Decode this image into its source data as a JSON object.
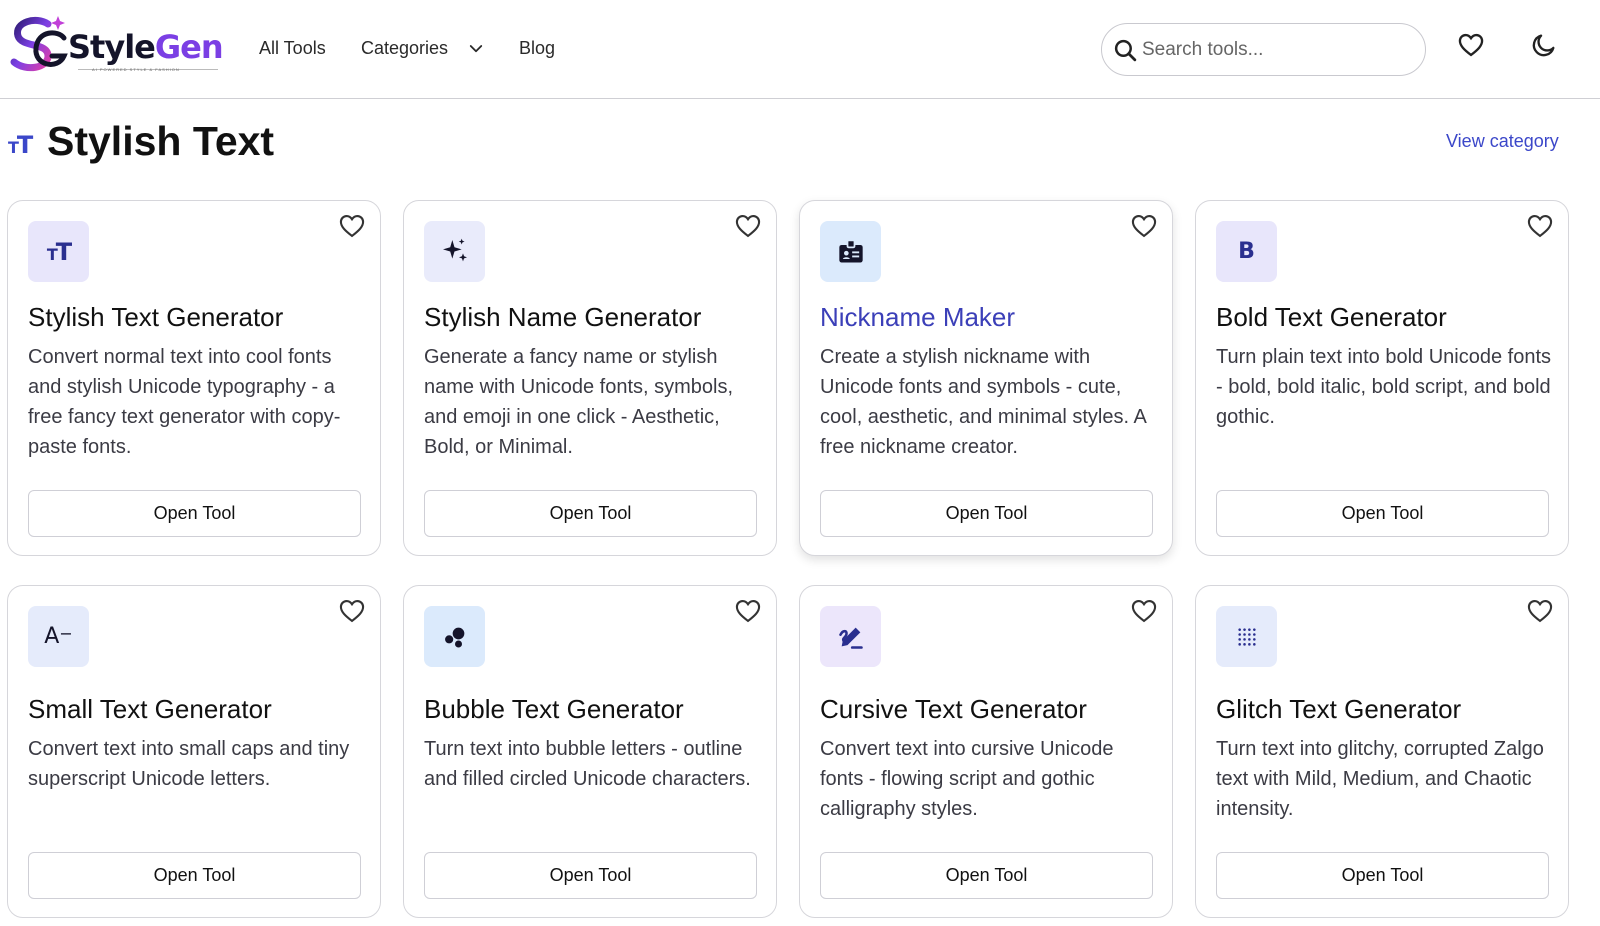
{
  "brand": {
    "name_part1": "Style",
    "name_part2": "Gen",
    "tagline": "AI POWERED STYLE & FASHION"
  },
  "nav": {
    "all_tools": "All Tools",
    "categories": "Categories",
    "blog": "Blog"
  },
  "search": {
    "placeholder": "Search tools..."
  },
  "section": {
    "title": "Stylish Text",
    "view_link": "View category"
  },
  "cards": [
    {
      "title": "Stylish Text Generator",
      "description": "Convert normal text into cool fonts and stylish Unicode typography - a free fancy text generator with copy-paste fonts.",
      "button": "Open Tool",
      "icon": "text-size-icon",
      "icon_bg": "#e8e6fb"
    },
    {
      "title": "Stylish Name Generator",
      "description": "Generate a fancy name or stylish name with Unicode fonts, symbols, and emoji in one click - Aesthetic, Bold, or Minimal.",
      "button": "Open Tool",
      "icon": "sparkles-icon",
      "icon_bg": "#e9ebfb"
    },
    {
      "title": "Nickname Maker",
      "description": "Create a stylish nickname with Unicode fonts and symbols - cute, cool, aesthetic, and minimal styles. A free nickname creator.",
      "button": "Open Tool",
      "icon": "id-badge-icon",
      "icon_bg": "#dbeafc",
      "title_color": "#3b3fb8"
    },
    {
      "title": "Bold Text Generator",
      "description": "Turn plain text into bold Unicode fonts - bold, bold italic, bold script, and bold gothic.",
      "button": "Open Tool",
      "icon": "bold-icon",
      "icon_bg": "#e8e6fb"
    },
    {
      "title": "Small Text Generator",
      "description": "Convert text into small caps and tiny superscript Unicode letters.",
      "button": "Open Tool",
      "icon": "font-decrease-icon",
      "icon_bg": "#e5ebfb"
    },
    {
      "title": "Bubble Text Generator",
      "description": "Turn text into bubble letters - outline and filled circled Unicode characters.",
      "button": "Open Tool",
      "icon": "bubbles-icon",
      "icon_bg": "#dbeafc"
    },
    {
      "title": "Cursive Text Generator",
      "description": "Convert text into cursive Unicode fonts - flowing script and gothic calligraphy styles.",
      "button": "Open Tool",
      "icon": "signature-icon",
      "icon_bg": "#ece6fb"
    },
    {
      "title": "Glitch Text Generator",
      "description": "Turn text into glitchy, corrupted Zalgo text with Mild, Medium, and Chaotic intensity.",
      "button": "Open Tool",
      "icon": "dot-grid-icon",
      "icon_bg": "#e5ebfb"
    }
  ]
}
